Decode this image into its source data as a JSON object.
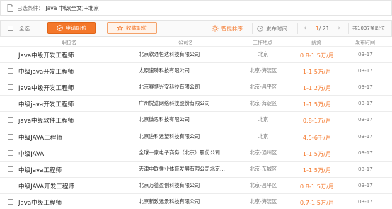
{
  "filter": {
    "label": "已选条件：",
    "value": "Java  中级(全文)+北京"
  },
  "toolbar": {
    "select_all": "全选",
    "apply_label": "申请职位",
    "favorite_label": "收藏职位",
    "smart_sort": "智能排序",
    "publish_time": "发布时间",
    "page_current": "1",
    "page_total": "/ 21",
    "total_count": "共1037条职位"
  },
  "columns": {
    "title": "职位名",
    "company": "公司名",
    "location": "工作地点",
    "salary": "薪资",
    "date": "发布时间"
  },
  "jobs": [
    {
      "title": "Java中级开发工程师",
      "company": "北京软通恒达科技有限公司",
      "location": "北京",
      "salary": "0.8-1.5万/月",
      "date": "03-17"
    },
    {
      "title": "中级java开发工程师",
      "company": "太原速聘科技有限公司",
      "location": "北京-海淀区",
      "salary": "1-1.5万/月",
      "date": "03-17"
    },
    {
      "title": "Java中级开发工程师",
      "company": "北京赛博兴安科技有限公司",
      "location": "北京-昌平区",
      "salary": "1-1.2万/月",
      "date": "03-17"
    },
    {
      "title": "中级java开发工程师",
      "company": "广州悦途网络科技股份有限公司",
      "location": "北京-海淀区",
      "salary": "1-1.5万/月",
      "date": "03-17"
    },
    {
      "title": "java中级软件工程师",
      "company": "北京微思科技有限公司",
      "location": "北京",
      "salary": "0.8-1万/月",
      "date": "03-17"
    },
    {
      "title": "中级JAVA工程师",
      "company": "北京迪科远望科技有限公司",
      "location": "北京",
      "salary": "4.5-6千/月",
      "date": "03-17"
    },
    {
      "title": "中级JAVA",
      "company": "全球一家电子商务（北京）股份公司",
      "location": "北京-通州区",
      "salary": "1-1.5万/月",
      "date": "03-17"
    },
    {
      "title": "中级Java工程师",
      "company": "天津中联惟业体育发展有限公司北京...",
      "location": "北京-东城区",
      "salary": "1-1.5万/月",
      "date": "03-17"
    },
    {
      "title": "中级JAVA开发工程师",
      "company": "北京万德盈创科技有限公司",
      "location": "北京-昌平区",
      "salary": "0.8-1.5万/月",
      "date": "03-17"
    },
    {
      "title": "Java中级工程师",
      "company": "北京新致远景科技有限公司",
      "location": "北京-海淀区",
      "salary": "0.7-1.5万/月",
      "date": "03-17"
    }
  ],
  "colors": {
    "accent": "#f4772a",
    "accent_light": "#fff3ea"
  }
}
